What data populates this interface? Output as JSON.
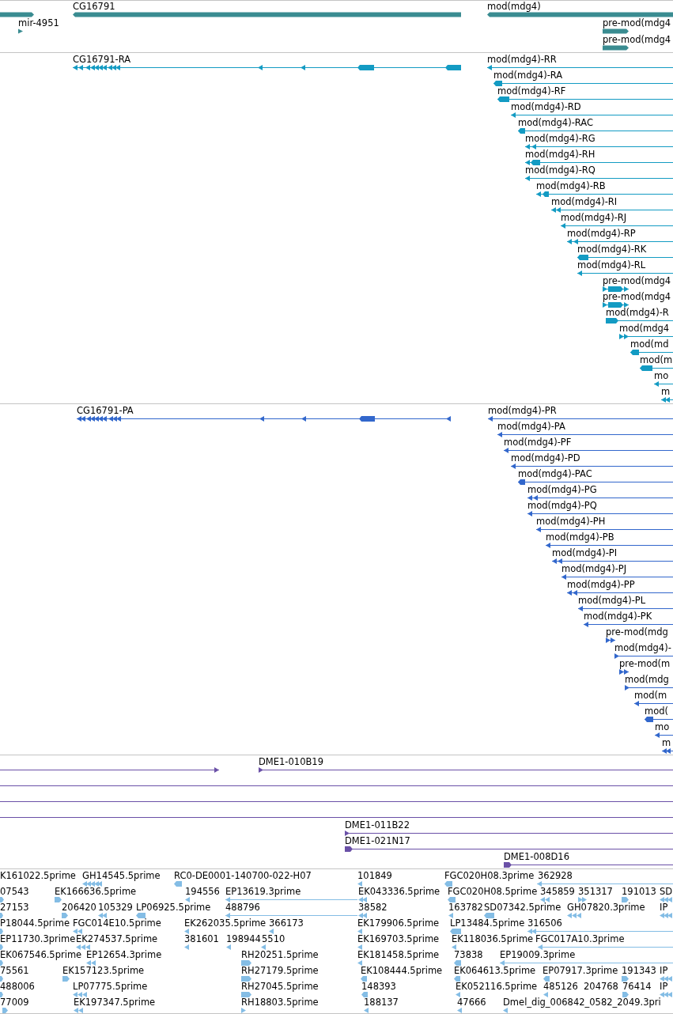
{
  "tracks": [
    {
      "kind": "gene",
      "features": [
        {
          "reverse": false
        },
        {
          "label": "mir-4951",
          "reverse": false
        },
        {
          "label": "CG16791",
          "reverse": true
        },
        {
          "label": "mod(mdg4)",
          "reverse": true
        },
        {
          "label": "pre-mod(mdg4",
          "reverse": false
        },
        {
          "label": "pre-mod(mdg4",
          "reverse": false
        }
      ]
    },
    {
      "kind": "transcript",
      "features": [
        {
          "label": "CG16791-RA",
          "reverse": true
        },
        {
          "label": "mod(mdg4)-RR",
          "reverse": true
        },
        {
          "label": "mod(mdg4)-RA",
          "reverse": true
        },
        {
          "label": "mod(mdg4)-RF",
          "reverse": true
        },
        {
          "label": "mod(mdg4)-RD",
          "reverse": true
        },
        {
          "label": "mod(mdg4)-RAC",
          "reverse": true
        },
        {
          "label": "mod(mdg4)-RG",
          "reverse": true
        },
        {
          "label": "mod(mdg4)-RH",
          "reverse": true
        },
        {
          "label": "mod(mdg4)-RQ",
          "reverse": true
        },
        {
          "label": "mod(mdg4)-RB",
          "reverse": true
        },
        {
          "label": "mod(mdg4)-RI",
          "reverse": true
        },
        {
          "label": "mod(mdg4)-RJ",
          "reverse": true
        },
        {
          "label": "mod(mdg4)-RP",
          "reverse": true
        },
        {
          "label": "mod(mdg4)-RK",
          "reverse": true
        },
        {
          "label": "mod(mdg4)-RL",
          "reverse": true
        },
        {
          "label": "pre-mod(mdg4",
          "reverse": false
        },
        {
          "label": "pre-mod(mdg4",
          "reverse": false
        },
        {
          "label": "mod(mdg4)-R",
          "reverse": false
        },
        {
          "label": "mod(mdg4",
          "reverse": false
        },
        {
          "label": "mod(md",
          "reverse": true
        },
        {
          "label": "mod(m",
          "reverse": true
        },
        {
          "label": "mo",
          "reverse": true
        },
        {
          "label": "m",
          "reverse": true
        }
      ]
    },
    {
      "kind": "protein",
      "features": [
        {
          "label": "CG16791-PA",
          "reverse": true
        },
        {
          "label": "mod(mdg4)-PR",
          "reverse": true
        },
        {
          "label": "mod(mdg4)-PA",
          "reverse": true
        },
        {
          "label": "mod(mdg4)-PF",
          "reverse": true
        },
        {
          "label": "mod(mdg4)-PD",
          "reverse": true
        },
        {
          "label": "mod(mdg4)-PAC",
          "reverse": true
        },
        {
          "label": "mod(mdg4)-PG",
          "reverse": true
        },
        {
          "label": "mod(mdg4)-PQ",
          "reverse": true
        },
        {
          "label": "mod(mdg4)-PH",
          "reverse": true
        },
        {
          "label": "mod(mdg4)-PB",
          "reverse": true
        },
        {
          "label": "mod(mdg4)-PI",
          "reverse": true
        },
        {
          "label": "mod(mdg4)-PJ",
          "reverse": true
        },
        {
          "label": "mod(mdg4)-PP",
          "reverse": true
        },
        {
          "label": "mod(mdg4)-PL",
          "reverse": true
        },
        {
          "label": "mod(mdg4)-PK",
          "reverse": true
        },
        {
          "label": "pre-mod(mdg",
          "reverse": false
        },
        {
          "label": "mod(mdg4)-",
          "reverse": false
        },
        {
          "label": "pre-mod(m",
          "reverse": false
        },
        {
          "label": "mod(mdg",
          "reverse": false
        },
        {
          "label": "mod(m",
          "reverse": true
        },
        {
          "label": "mod(",
          "reverse": true
        },
        {
          "label": "mo",
          "reverse": true
        },
        {
          "label": "m",
          "reverse": true
        }
      ]
    },
    {
      "kind": "clone",
      "features": [
        {
          "kind": "feature",
          "reverse": false
        },
        {
          "kind": "feature",
          "label": "DME1-010B19",
          "reverse": false
        },
        {
          "kind": "through"
        },
        {
          "kind": "through"
        },
        {
          "kind": "through"
        },
        {
          "kind": "feature",
          "label": "DME1-011B22",
          "reverse": false
        },
        {
          "kind": "feature",
          "label": "DME1-021N17",
          "reverse": false
        },
        {
          "kind": "feature",
          "label": "DME1-008D16",
          "reverse": false
        }
      ]
    },
    {
      "kind": "est",
      "features": [
        {
          "label": "K161022.5prime"
        },
        {
          "label": "GH14545.5prime",
          "reverse": true
        },
        {
          "label": "RC0-DE0001-140700-022-H07",
          "reverse": true
        },
        {
          "label": "101849",
          "reverse": true
        },
        {
          "label": "FGC020H08.3prime",
          "reverse": true
        },
        {
          "label": "362928",
          "reverse": true
        },
        {
          "label": "07543",
          "reverse": false
        },
        {
          "label": "EK166636.5prime",
          "reverse": false
        },
        {
          "label": "194556",
          "reverse": true
        },
        {
          "label": "EP13619.3prime",
          "reverse": true
        },
        {
          "label": "EK043336.5prime",
          "reverse": true
        },
        {
          "label": "FGC020H08.5prime",
          "reverse": true
        },
        {
          "label": "345859",
          "reverse": true
        },
        {
          "label": "351317",
          "reverse": false
        },
        {
          "label": "191013",
          "reverse": false
        },
        {
          "label": "SD",
          "reverse": true
        },
        {
          "label": "27153",
          "reverse": false
        },
        {
          "label": "206420",
          "reverse": false
        },
        {
          "label": "105329",
          "reverse": true
        },
        {
          "label": "LP06925.5prime",
          "reverse": true
        },
        {
          "label": "488796",
          "reverse": true
        },
        {
          "label": "38582",
          "reverse": true
        },
        {
          "label": "163782",
          "reverse": true
        },
        {
          "label": "SD07342.5prime",
          "reverse": true
        },
        {
          "label": "GH07820.3prime",
          "reverse": true
        },
        {
          "label": "IP",
          "reverse": true
        },
        {
          "label": "P18044.5prime",
          "reverse": false
        },
        {
          "label": "FGC014E10.5prime",
          "reverse": true
        },
        {
          "label": "EK262035.5prime",
          "reverse": true
        },
        {
          "label": "366173",
          "reverse": true
        },
        {
          "label": "EK179906.5prime",
          "reverse": true
        },
        {
          "label": "LP13484.5prime",
          "reverse": true
        },
        {
          "label": "316506",
          "reverse": true
        },
        {
          "label": "EP11730.3prime",
          "reverse": false
        },
        {
          "label": "EK274537.5prime",
          "reverse": true
        },
        {
          "label": "381601",
          "reverse": true
        },
        {
          "label": "198944",
          "reverse": true
        },
        {
          "label": "5510",
          "reverse": true
        },
        {
          "label": "EK169703.5prime",
          "reverse": true
        },
        {
          "label": "EK118036.5prime",
          "reverse": true
        },
        {
          "label": "FGC017A10.3prime",
          "reverse": true
        },
        {
          "label": "EK067546.5prime",
          "reverse": false
        },
        {
          "label": "EP12654.3prime",
          "reverse": true
        },
        {
          "label": "RH20251.5prime",
          "reverse": false
        },
        {
          "label": "EK181458.5prime",
          "reverse": true
        },
        {
          "label": "73838",
          "reverse": true
        },
        {
          "label": "EP19009.3prime",
          "reverse": true
        },
        {
          "label": "75561",
          "reverse": false
        },
        {
          "label": "EK157123.5prime",
          "reverse": false
        },
        {
          "label": "RH27179.5prime",
          "reverse": false
        },
        {
          "label": "EK108444.5prime",
          "reverse": true
        },
        {
          "label": "EK064613.5prime",
          "reverse": true
        },
        {
          "label": "EP07917.3prime",
          "reverse": true
        },
        {
          "label": "191343",
          "reverse": false
        },
        {
          "label": "IP",
          "reverse": true
        },
        {
          "label": "488006",
          "reverse": false
        },
        {
          "label": "LP07775.5prime",
          "reverse": true
        },
        {
          "label": "RH27045.5prime",
          "reverse": false
        },
        {
          "label": "148393",
          "reverse": true
        },
        {
          "label": "EK052116.5prime",
          "reverse": true
        },
        {
          "label": "485126",
          "reverse": true
        },
        {
          "label": "204768"
        },
        {
          "label": "76414",
          "reverse": false
        },
        {
          "label": "IP",
          "reverse": true
        },
        {
          "label": "77009",
          "reverse": false
        },
        {
          "label": "EK197347.5prime",
          "reverse": true
        },
        {
          "label": "RH18803.5prime",
          "reverse": false
        },
        {
          "label": "188137",
          "reverse": true
        },
        {
          "label": "47666",
          "reverse": true
        },
        {
          "label": "Dmel_dig_006842_0582_2049.3pri",
          "reverse": true
        }
      ]
    }
  ]
}
